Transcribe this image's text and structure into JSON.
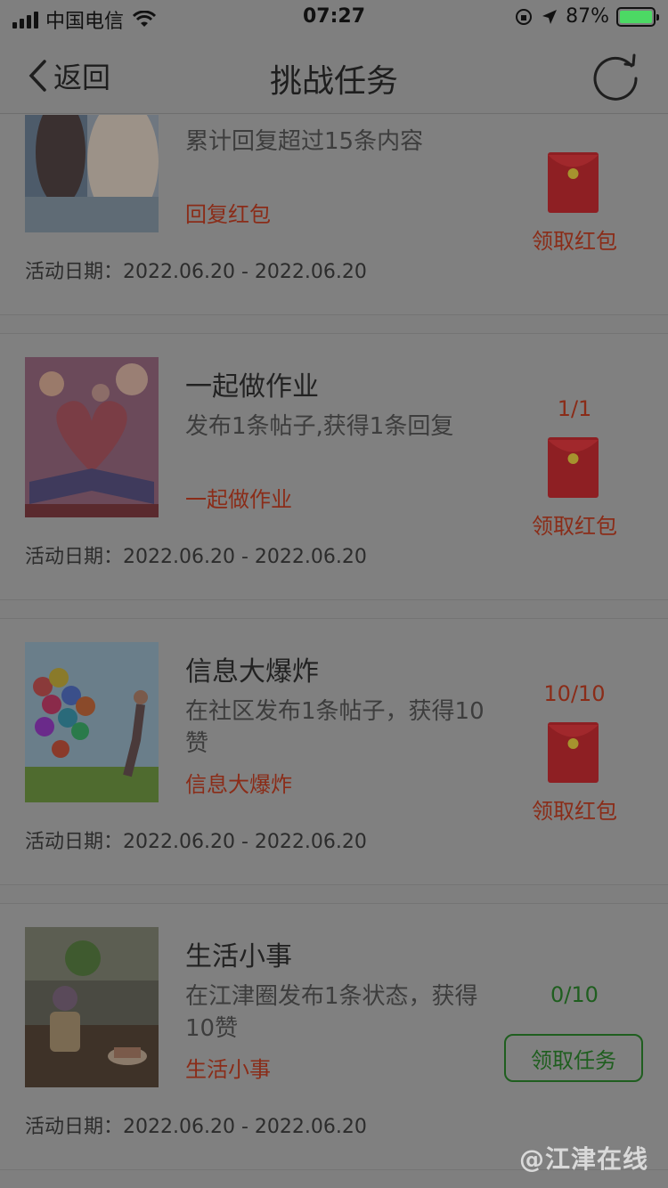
{
  "status_bar": {
    "carrier": "中国电信",
    "time": "07:27",
    "battery": "87%"
  },
  "nav": {
    "back_label": "返回",
    "title": "挑战任务"
  },
  "tasks": [
    {
      "title": "",
      "desc": "累计回复超过15条内容",
      "tag": "回复红包",
      "date": "活动日期：2022.06.20 - 2022.06.20",
      "progress": "",
      "action": "领取红包",
      "action_type": "envelope",
      "image": "people-photo"
    },
    {
      "title": "一起做作业",
      "desc": "发布1条帖子,获得1条回复",
      "tag": "一起做作业",
      "date": "活动日期：2022.06.20 - 2022.06.20",
      "progress": "1/1",
      "action": "领取红包",
      "action_type": "envelope",
      "image": "book-heart-photo"
    },
    {
      "title": "信息大爆炸",
      "desc": "在社区发布1条帖子，获得10赞",
      "tag": "信息大爆炸",
      "date": "活动日期：2022.06.20 - 2022.06.20",
      "progress": "10/10",
      "action": "领取红包",
      "action_type": "envelope",
      "image": "balloons-photo"
    },
    {
      "title": "生活小事",
      "desc": "在江津圈发布1条状态，获得10赞",
      "tag": "生活小事",
      "date": "活动日期：2022.06.20 - 2022.06.20",
      "progress": "0/10",
      "action": "领取任务",
      "action_type": "button",
      "image": "flowers-cafe-photo"
    }
  ],
  "watermark": "@江津在线",
  "colors": {
    "overlay_bg": "#7f7f7f",
    "accent_red": "#8a2c18",
    "accent_green": "#1f5e1f",
    "envelope_red": "#b8262b"
  }
}
